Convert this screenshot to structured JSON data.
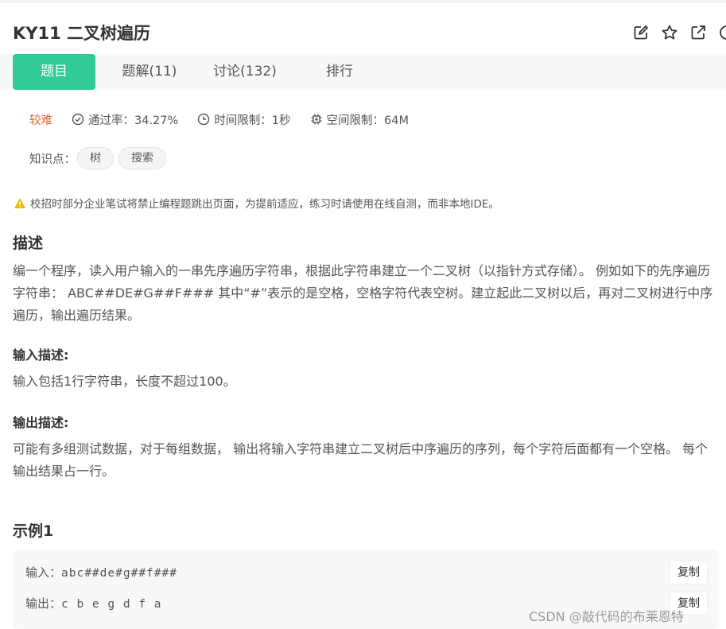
{
  "problem": {
    "title": "KY11  二叉树遍历",
    "actions": [
      "edit-icon",
      "star-icon",
      "share-icon",
      "more-icon"
    ]
  },
  "tabs": [
    {
      "label": "题目",
      "active": true
    },
    {
      "label": "题解(11)",
      "active": false
    },
    {
      "label": "讨论(132)",
      "active": false
    },
    {
      "label": "排行",
      "active": false
    }
  ],
  "meta": {
    "difficulty": "较难",
    "pass_rate": "通过率：34.27%",
    "time_limit": "时间限制：1秒",
    "space_limit": "空间限制：64M"
  },
  "knowledge": {
    "label": "知识点：",
    "tags": [
      "树",
      "搜索"
    ]
  },
  "notice": "校招时部分企业笔试将禁止编程题跳出页面，为提前适应，练习时请使用在线自测，而非本地IDE。",
  "description": {
    "title": "描述",
    "text": "编一个程序，读入用户输入的一串先序遍历字符串，根据此字符串建立一个二叉树（以指针方式存储）。 例如如下的先序遍历字符串： ABC##DE#G##F### 其中“#”表示的是空格，空格字符代表空树。建立起此二叉树以后，再对二叉树进行中序遍历，输出遍历结果。"
  },
  "input_desc": {
    "title": "输入描述:",
    "text": "输入包括1行字符串，长度不超过100。"
  },
  "output_desc": {
    "title": "输出描述:",
    "text": "可能有多组测试数据，对于每组数据， 输出将输入字符串建立二叉树后中序遍历的序列，每个字符后面都有一个空格。 每个输出结果占一行。"
  },
  "example": {
    "title": "示例1",
    "input_label": "输入：",
    "input_value": "abc##de#g##f###",
    "output_label": "输出：",
    "output_value": "c b e g d f a",
    "copy_label": "复制"
  },
  "watermark": "CSDN @敲代码的布莱恩特",
  "colors": {
    "accent": "#32ca99",
    "difficulty": "#e8632d",
    "warning": "#f5b800"
  }
}
